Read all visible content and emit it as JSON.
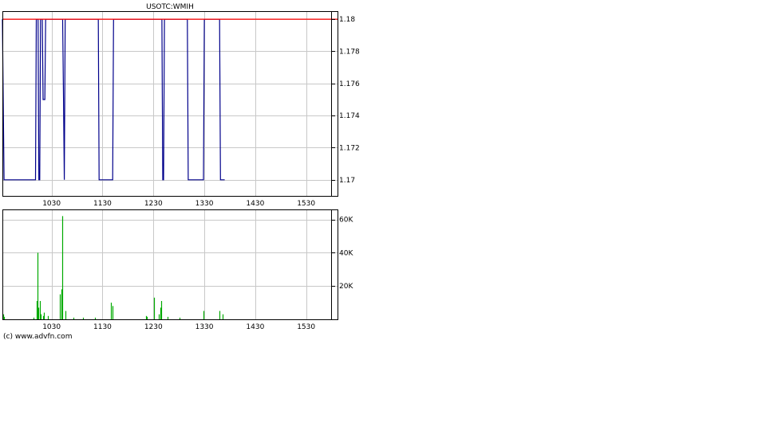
{
  "chart_data": [
    {
      "type": "line",
      "title": "USOTC:WMIH",
      "x_tick_labels": [
        "1030",
        "1130",
        "1230",
        "1330",
        "1430",
        "1530"
      ],
      "x_ticks_min": [
        630,
        690,
        750,
        810,
        870,
        930
      ],
      "x_range_min": [
        572,
        967
      ],
      "ylim": [
        1.169,
        1.1805
      ],
      "y_ticks": [
        1.17,
        1.172,
        1.174,
        1.176,
        1.178,
        1.18
      ],
      "y_tick_labels": [
        "1.17",
        "1.172",
        "1.174",
        "1.176",
        "1.178",
        "1.18"
      ],
      "grid": true,
      "series": [
        {
          "color": "#00008b",
          "points": [
            [
              572,
              1.18
            ],
            [
              574,
              1.17
            ],
            [
              611,
              1.17
            ],
            [
              612,
              1.18
            ],
            [
              614,
              1.18
            ],
            [
              615,
              1.17
            ],
            [
              616,
              1.17
            ],
            [
              617,
              1.18
            ],
            [
              619,
              1.18
            ],
            [
              620,
              1.175
            ],
            [
              622,
              1.175
            ],
            [
              623,
              1.18
            ],
            [
              643,
              1.18
            ],
            [
              644,
              1.175
            ],
            [
              645,
              1.17
            ],
            [
              646,
              1.18
            ],
            [
              685,
              1.18
            ],
            [
              686,
              1.17
            ],
            [
              702,
              1.17
            ],
            [
              703,
              1.18
            ],
            [
              760,
              1.18
            ],
            [
              761,
              1.17
            ],
            [
              762,
              1.17
            ],
            [
              763,
              1.18
            ],
            [
              790,
              1.18
            ],
            [
              791,
              1.17
            ],
            [
              809,
              1.17
            ],
            [
              810,
              1.18
            ],
            [
              828,
              1.18
            ],
            [
              829,
              1.17
            ],
            [
              834,
              1.17
            ]
          ]
        },
        {
          "color": "#ff0000",
          "points": [
            [
              572,
              1.18
            ],
            [
              967,
              1.18
            ]
          ]
        }
      ]
    },
    {
      "type": "bar",
      "title": "",
      "x_tick_labels": [
        "1030",
        "1130",
        "1230",
        "1330",
        "1430",
        "1530"
      ],
      "x_ticks_min": [
        630,
        690,
        750,
        810,
        870,
        930
      ],
      "x_range_min": [
        572,
        967
      ],
      "ylim": [
        0,
        66000
      ],
      "y_ticks": [
        20000,
        40000,
        60000
      ],
      "y_tick_labels": [
        "20K",
        "40K",
        "60K"
      ],
      "grid": true,
      "color": "#00aa00",
      "bars": [
        [
          573,
          3000
        ],
        [
          574,
          1500
        ],
        [
          609,
          1000
        ],
        [
          612,
          11000
        ],
        [
          613,
          40000
        ],
        [
          614,
          7000
        ],
        [
          616,
          11000
        ],
        [
          617,
          3000
        ],
        [
          620,
          2000
        ],
        [
          621,
          4000
        ],
        [
          626,
          2000
        ],
        [
          640,
          15000
        ],
        [
          642,
          18000
        ],
        [
          643,
          62000
        ],
        [
          646,
          5000
        ],
        [
          656,
          1000
        ],
        [
          667,
          1000
        ],
        [
          681,
          1000
        ],
        [
          700,
          10000
        ],
        [
          702,
          8000
        ],
        [
          741,
          2000
        ],
        [
          742,
          1500
        ],
        [
          751,
          13000
        ],
        [
          756,
          3000
        ],
        [
          758,
          7000
        ],
        [
          759,
          11000
        ],
        [
          767,
          1500
        ],
        [
          781,
          1000
        ],
        [
          809,
          5000
        ],
        [
          828,
          5000
        ],
        [
          832,
          3000
        ]
      ]
    }
  ],
  "footer": {
    "credit": "(c) www.advfn.com"
  }
}
